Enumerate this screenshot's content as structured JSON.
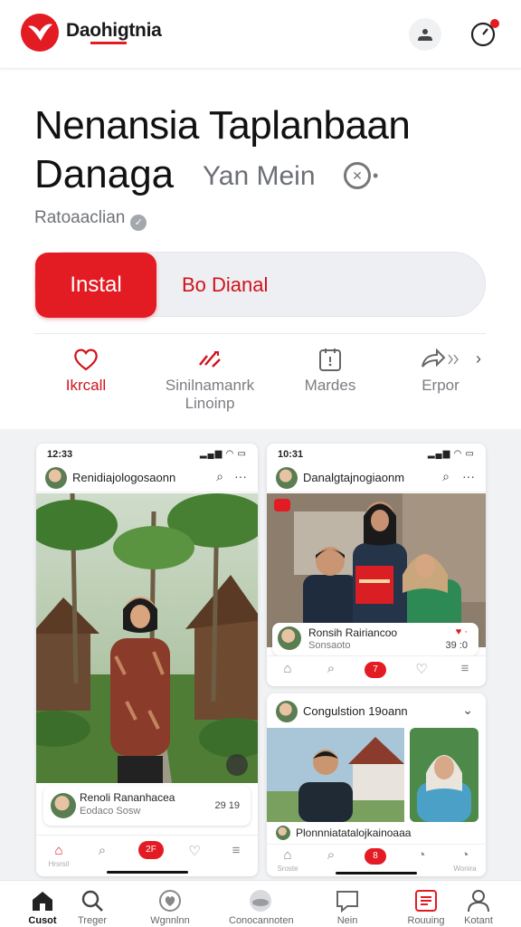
{
  "header": {
    "app_name": "Daohigtnia",
    "profile_button_icon": "account-icon",
    "notification_icon": "clock-icon"
  },
  "hero": {
    "title_line1": "Nenansia Taplanbaan",
    "title_line2": "Danaga",
    "title_secondary": "Yan Mein",
    "title_dots": "•",
    "meta": "Ratoaaclian",
    "install_label": "Instal",
    "alt_label": "Bo Dianal"
  },
  "actions": [
    {
      "label": "Ikrcall",
      "icon": "heart-icon"
    },
    {
      "label": "Sinilnamanrk Linoinp",
      "icon": "shuffle-icon"
    },
    {
      "label": "Mardes",
      "icon": "calendar-icon"
    },
    {
      "label": "Erpor",
      "icon": "share-icon"
    }
  ],
  "gallery": {
    "shot1": {
      "time": "12:33",
      "account": "Renidiajologosaonn",
      "caption_title": "Renoli Rananhacea",
      "caption_sub": "Eodaco Sosw",
      "caption_right": "29 19",
      "tabs": {
        "home": "Hrsrsil",
        "pill": "2F"
      }
    },
    "shot2": {
      "time": "10:31",
      "account": "Danalgtajnogiaonm",
      "caption_title": "Ronsih Rairiancoo",
      "caption_sub": "Sonsaoto",
      "caption_right": "39 :0",
      "pill": "7"
    },
    "shot3": {
      "account": "Congulstion 19oann",
      "caption_title": "Plonnniatatalojkainoaaa",
      "tabs": {
        "home": "Sroste",
        "right": "Wonira",
        "pill": "8"
      }
    }
  },
  "bottom_nav": [
    {
      "label": "Cusot",
      "icon": "home-icon"
    },
    {
      "label": "Treger",
      "icon": "search-icon"
    },
    {
      "label": "Wgnnlnn",
      "icon": "heart-icon"
    },
    {
      "label": "Conocannoten",
      "icon": "globe-icon"
    },
    {
      "label": "Nein",
      "icon": "chat-icon"
    },
    {
      "label": "Rouuing",
      "icon": "list-icon"
    },
    {
      "label": "Kotant",
      "icon": "profile-icon"
    }
  ],
  "colors": {
    "accent": "#e31b23",
    "text": "#111111",
    "muted": "#7a7d82"
  }
}
